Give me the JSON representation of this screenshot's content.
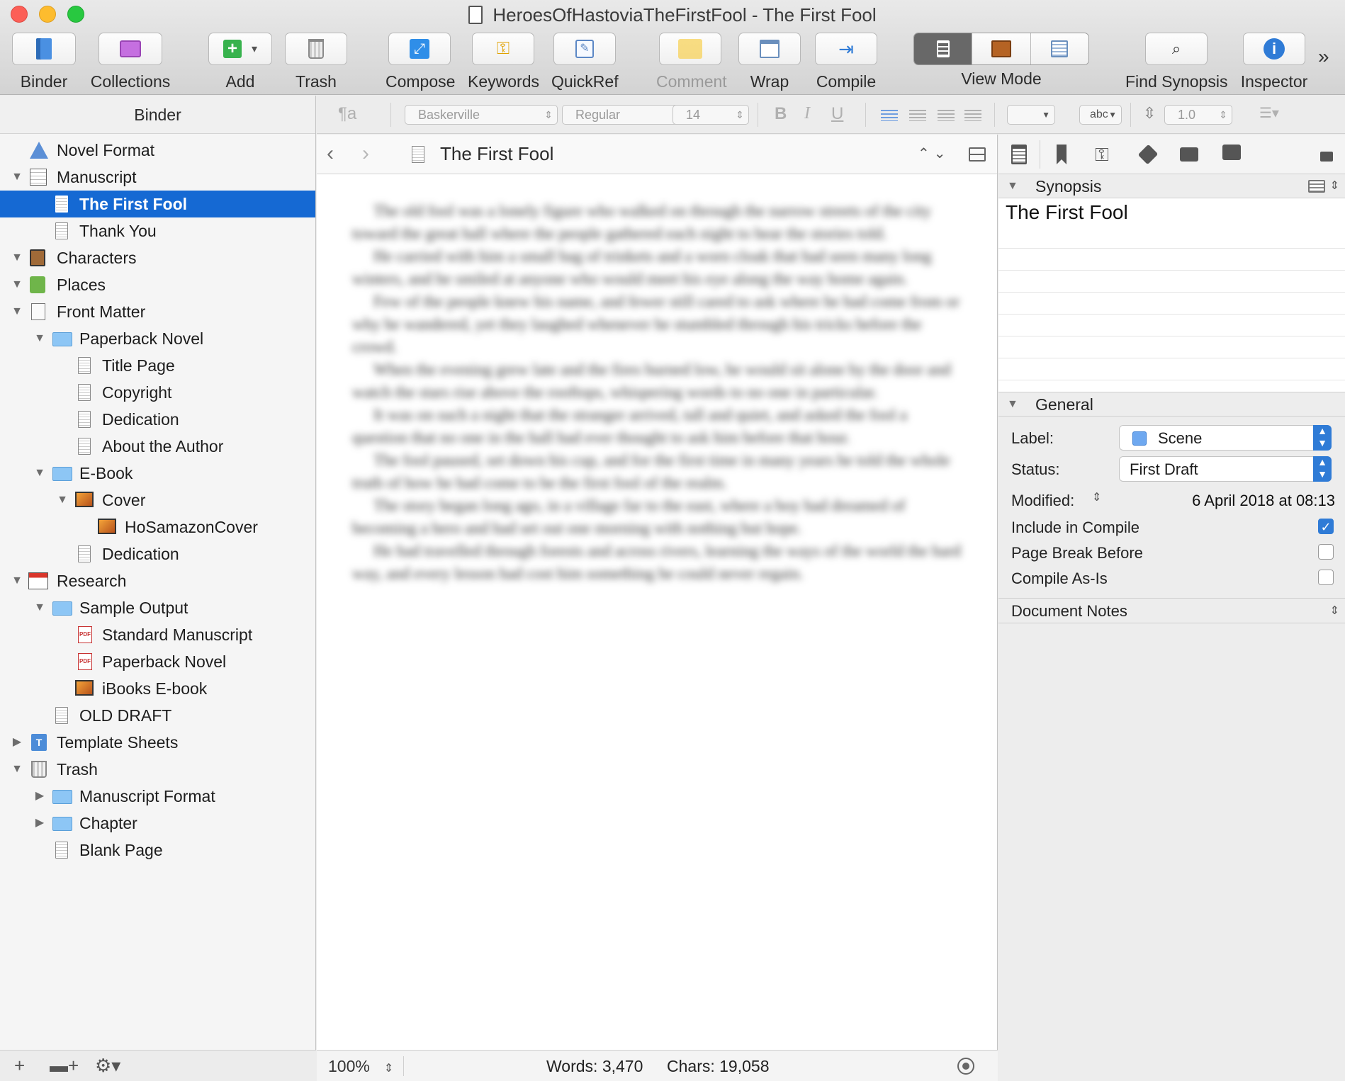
{
  "window": {
    "title": "HeroesOfHastoviaTheFirstFool - The First Fool"
  },
  "toolbar": {
    "binder": "Binder",
    "collections": "Collections",
    "add": "Add",
    "trash": "Trash",
    "compose": "Compose",
    "keywords": "Keywords",
    "quickref": "QuickRef",
    "comment": "Comment",
    "wrap": "Wrap",
    "compile": "Compile",
    "view_mode": "View Mode",
    "find_synopsis": "Find Synopsis",
    "inspector": "Inspector"
  },
  "binder": {
    "header": "Binder",
    "items": [
      {
        "label": "Novel Format"
      },
      {
        "label": "Manuscript"
      },
      {
        "label": "The First Fool"
      },
      {
        "label": "Thank You"
      },
      {
        "label": "Characters"
      },
      {
        "label": "Places"
      },
      {
        "label": "Front Matter"
      },
      {
        "label": "Paperback Novel"
      },
      {
        "label": "Title Page"
      },
      {
        "label": "Copyright"
      },
      {
        "label": "Dedication"
      },
      {
        "label": "About the Author"
      },
      {
        "label": "E-Book"
      },
      {
        "label": "Cover"
      },
      {
        "label": "HoSamazonCover"
      },
      {
        "label": "Dedication"
      },
      {
        "label": "Research"
      },
      {
        "label": "Sample Output"
      },
      {
        "label": "Standard Manuscript"
      },
      {
        "label": "Paperback Novel"
      },
      {
        "label": "iBooks E-book"
      },
      {
        "label": "OLD DRAFT"
      },
      {
        "label": "Template Sheets"
      },
      {
        "label": "Trash"
      },
      {
        "label": "Manuscript Format"
      },
      {
        "label": "Chapter"
      },
      {
        "label": "Blank Page"
      }
    ]
  },
  "format_bar": {
    "style_glyph": "¶a",
    "font": "Baskerville",
    "weight": "Regular",
    "size": "14",
    "bold": "B",
    "italic": "I",
    "underline": "U",
    "highlight": "abc",
    "line_spacing": "1.0"
  },
  "editor": {
    "doc_title": "The First Fool",
    "zoom": "100%",
    "words": "Words: 3,470",
    "chars": "Chars: 19,058"
  },
  "inspector": {
    "synopsis_header": "Synopsis",
    "synopsis_title": "The First Fool",
    "general_header": "General",
    "label_caption": "Label:",
    "label_value": "Scene",
    "label_color": "#6ea8f0",
    "status_caption": "Status:",
    "status_value": "First Draft",
    "modified_caption": "Modified:",
    "modified_value": "6 April 2018 at 08:13",
    "include_in_compile": "Include in Compile",
    "include_in_compile_checked": true,
    "page_break_before": "Page Break Before",
    "page_break_before_checked": false,
    "compile_as_is": "Compile As-Is",
    "compile_as_is_checked": false,
    "document_notes": "Document Notes"
  }
}
